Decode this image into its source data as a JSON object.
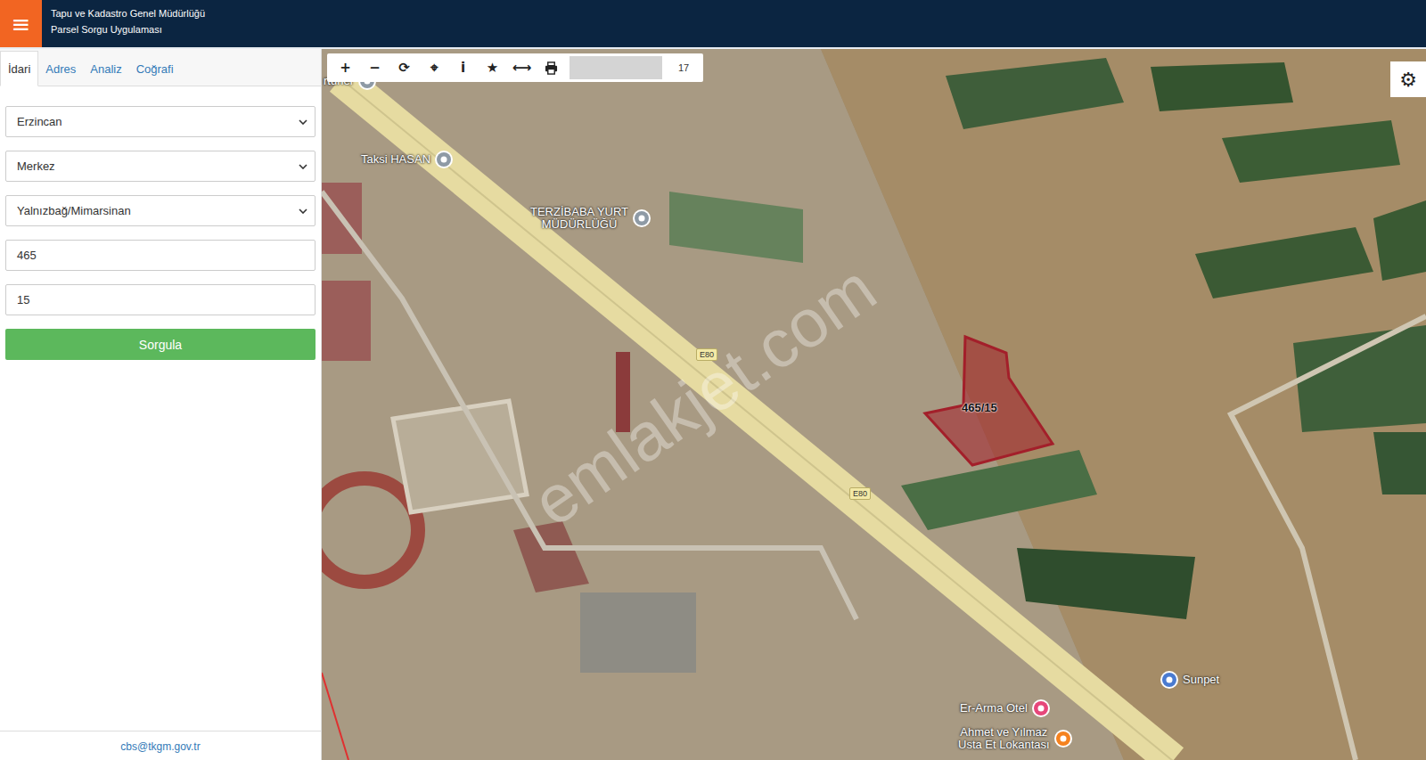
{
  "header": {
    "menu_icon": "≡",
    "title": "Tapu ve Kadastro Genel Müdürlüğü",
    "subtitle": "Parsel Sorgu Uygulaması"
  },
  "tabs": [
    {
      "label": "İdari",
      "selected": true
    },
    {
      "label": "Adres",
      "selected": false
    },
    {
      "label": "Analiz",
      "selected": false
    },
    {
      "label": "Coğrafi",
      "selected": false
    }
  ],
  "fields": [
    {
      "kind": "select",
      "value": "Erzincan"
    },
    {
      "kind": "select",
      "value": "Merkez"
    },
    {
      "kind": "select",
      "value": "Yalnızbağ/Mimarsinan"
    },
    {
      "kind": "input",
      "value": "465"
    },
    {
      "kind": "input",
      "value": "15"
    }
  ],
  "query_button": "Sorgula",
  "footer": "cbs@tkgm.gov.tr",
  "toolbar": {
    "tools": [
      "+",
      "−",
      "⟳",
      "⌖",
      "i",
      "★",
      "⟷"
    ],
    "zoom": "17"
  },
  "settings_icon": "⚙",
  "map": {
    "parcel": {
      "label": "465/15",
      "color": "#a31f2a"
    },
    "places": [
      {
        "lines": [
          "rtuner"
        ],
        "color": "#8e9aa5"
      },
      {
        "lines": [
          "Taksi HASAN"
        ],
        "color": "#8e9aa5"
      },
      {
        "lines": [
          "TERZİBABA YURT",
          "MÜDÜRLÜĞÜ"
        ],
        "color": "#8e9aa5"
      },
      {
        "lines": [
          "Er-Arma Otel"
        ],
        "color": "#e6477a"
      },
      {
        "lines": [
          "Ahmet ve Yılmaz",
          "Usta Et Lokantası"
        ],
        "color": "#f5821f"
      },
      {
        "lines": [
          "Sunpet"
        ],
        "color": "#4a7bd0"
      }
    ],
    "roads": [
      {
        "label": "E80"
      },
      {
        "label": "E80"
      }
    ],
    "watermark": "emlakjet.com"
  }
}
